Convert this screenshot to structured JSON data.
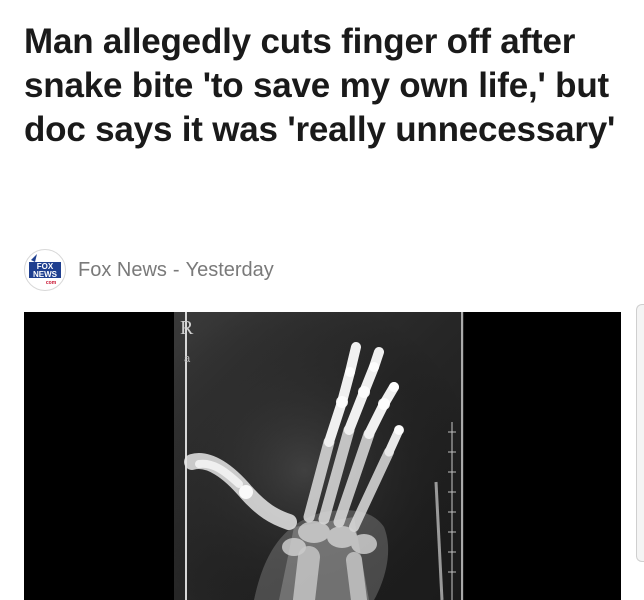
{
  "article": {
    "headline": "Man allegedly cuts finger off after snake bite 'to save my own life,' but doc says it was 'really unnecessary'",
    "source": "Fox News",
    "separator": "-",
    "time": "Yesterday",
    "logo": {
      "icon": "fox-news-logo-icon",
      "line1": "FOX",
      "line2": "NEWS",
      "line3": "com",
      "colors": {
        "blue": "#1f3f8f",
        "red": "#c8102e"
      }
    },
    "image": {
      "description_icon": "xray-hand-icon",
      "marker_r": "R",
      "marker_a": "a"
    }
  },
  "colors": {
    "headline": "#1a1a1a",
    "meta": "#7a7a7a",
    "background": "#ffffff"
  }
}
